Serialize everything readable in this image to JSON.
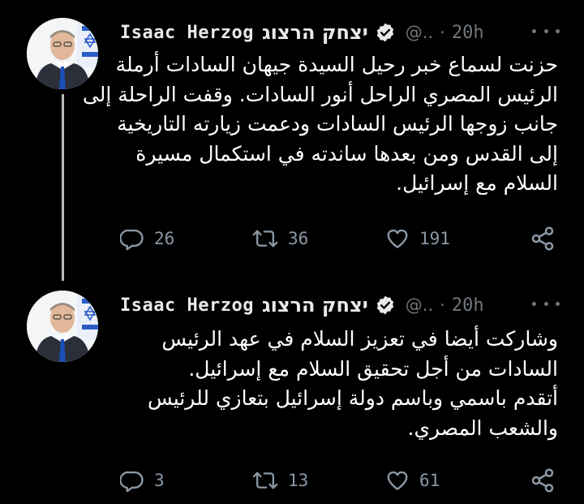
{
  "tweets": [
    {
      "author": {
        "name": "Isaac Herzog",
        "name_hebrew": "יצחק הרצוג",
        "handle": "@..",
        "verified": true
      },
      "separator": "·",
      "time": "20h",
      "body_lines": [
        "حزنت لسماع خبر رحيل السيدة جيهان السادات أرملة",
        "الرئيس المصري الراحل أنور السادات. وقفت الراحلة إلى",
        "جانب زوجها الرئيس السادات ودعمت زيارته التاريخية",
        "إلى القدس ومن بعدها ساندته في استكمال مسيرة",
        "السلام مع إسرائيل."
      ],
      "stats": {
        "replies": "26",
        "retweets": "36",
        "likes": "191"
      }
    },
    {
      "author": {
        "name": "Isaac Herzog",
        "name_hebrew": "יצחק הרצוג",
        "handle": "@..",
        "verified": true
      },
      "separator": "·",
      "time": "20h",
      "body_lines": [
        "وشاركت أيضا في تعزيز السلام في عهد الرئيس",
        "السادات من أجل تحقيق السلام مع إسرائيل.",
        "أتقدم باسمي وباسم دولة إسرائيل بتعازي للرئيس",
        "والشعب المصري."
      ],
      "stats": {
        "replies": "3",
        "retweets": "13",
        "likes": "61"
      }
    }
  ],
  "icons": {
    "reply": "reply-icon",
    "retweet": "retweet-icon",
    "like": "heart-icon",
    "share": "share-icon",
    "more": "more-icon",
    "verified": "verified-badge-icon"
  },
  "colors": {
    "background": "#000000",
    "text_primary": "#ffffff",
    "text_secondary": "#71767b",
    "icon": "#8b98a5",
    "thread_line": "#b8bcbf"
  }
}
